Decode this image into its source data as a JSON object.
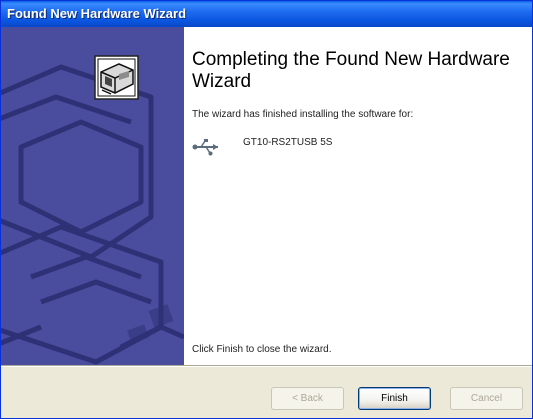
{
  "window": {
    "title": "Found New Hardware Wizard"
  },
  "main": {
    "heading": "Completing the Found New Hardware Wizard",
    "description": "The wizard has finished installing the software for:",
    "device_name": "GT10-RS2TUSB 5S",
    "finish_note": "Click Finish to close the wizard."
  },
  "buttons": {
    "back": "< Back",
    "finish": "Finish",
    "cancel": "Cancel"
  },
  "icons": {
    "wizard_icon": "hardware-wizard-icon",
    "device_icon": "usb-icon"
  },
  "colors": {
    "titlebar": "#0b56e0",
    "sidebar": "#4a4d9e",
    "sidebar_dark": "#2e3176",
    "window_bg": "#ece9d8"
  }
}
